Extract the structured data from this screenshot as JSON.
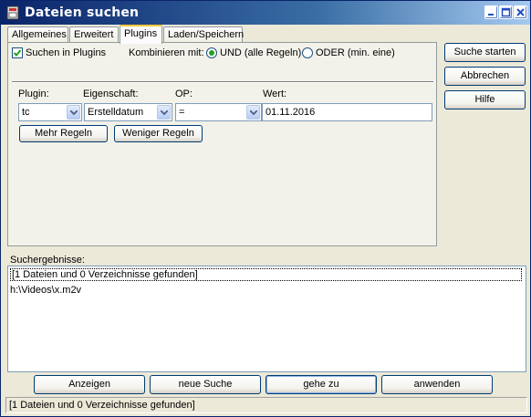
{
  "window": {
    "title": "Dateien suchen"
  },
  "tabs": [
    {
      "label": "Allgemeines"
    },
    {
      "label": "Erweitert"
    },
    {
      "label": "Plugins",
      "active": true
    },
    {
      "label": "Laden/Speichern"
    }
  ],
  "plugins_tab": {
    "search_in_plugins": {
      "label": "Suchen in Plugins",
      "checked": true
    },
    "combine_label": "Kombinieren mit:",
    "combine_options": [
      {
        "label": "UND (alle Regeln)",
        "selected": true
      },
      {
        "label": "ODER (min. eine)",
        "selected": false
      }
    ],
    "columns": {
      "plugin": "Plugin:",
      "property": "Eigenschaft:",
      "op": "OP:",
      "value": "Wert:"
    },
    "rule": {
      "plugin": "tc",
      "property": "Erstelldatum",
      "op": "=",
      "value": "01.11.2016"
    },
    "more_rules": "Mehr Regeln",
    "fewer_rules": "Weniger Regeln"
  },
  "side_buttons": {
    "start": "Suche starten",
    "cancel": "Abbrechen",
    "help": "Hilfe"
  },
  "results": {
    "label": "Suchergebnisse:",
    "items": [
      "[1 Dateien und 0 Verzeichnisse gefunden]",
      "h:\\Videos\\x.m2v"
    ]
  },
  "bottom_buttons": {
    "view": "Anzeigen",
    "new_search": "neue Suche",
    "goto": "gehe zu",
    "apply": "anwenden"
  },
  "status": "[1 Dateien und 0 Verzeichnisse gefunden]",
  "colors": {
    "accent_check": "#21a121",
    "titlebar": "#0a246a",
    "tab_highlight": "#ffc83c"
  },
  "icons": [
    "app-icon",
    "minimize-icon",
    "maximize-icon",
    "close-icon",
    "check-icon",
    "dropdown-arrow-icon"
  ]
}
